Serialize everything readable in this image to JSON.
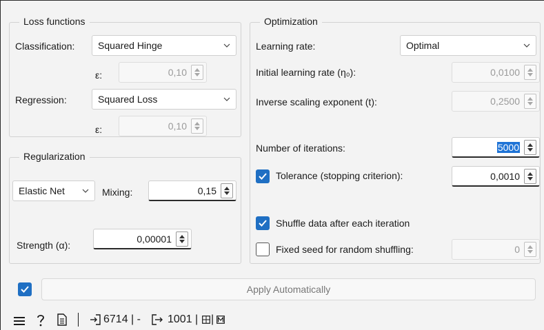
{
  "loss": {
    "title": "Loss functions",
    "classification_label": "Classification:",
    "classification_value": "Squared Hinge",
    "eps_label": "ε:",
    "class_eps": "0,10",
    "regression_label": "Regression:",
    "regression_value": "Squared Loss",
    "reg_eps": "0,10"
  },
  "regularization": {
    "title": "Regularization",
    "penalty_value": "Elastic Net",
    "mixing_label": "Mixing:",
    "mixing_value": "0,15",
    "strength_label": "Strength (α):",
    "strength_value": "0,00001"
  },
  "optimization": {
    "title": "Optimization",
    "learning_rate_label": "Learning rate:",
    "learning_rate_value": "Optimal",
    "initial_lr_label": "Initial learning rate (η₀):",
    "initial_lr_value": "0,0100",
    "inverse_label": "Inverse scaling exponent (t):",
    "inverse_value": "0,2500",
    "iterations_label": "Number of iterations:",
    "iterations_value": "5000",
    "tolerance_label": "Tolerance (stopping criterion):",
    "tolerance_value": "0,0010",
    "tolerance_checked": true,
    "shuffle_label": "Shuffle data after each iteration",
    "shuffle_checked": true,
    "fixed_seed_label": "Fixed seed for random shuffling:",
    "fixed_seed_checked": false,
    "fixed_seed_value": "0"
  },
  "apply": {
    "label": "Apply Automatically",
    "checked": true
  },
  "status": {
    "input_count": "6714 | -",
    "output_count": "1001 |"
  },
  "colors": {
    "accent": "#1f6fc3",
    "background": "#f3f3f3"
  }
}
